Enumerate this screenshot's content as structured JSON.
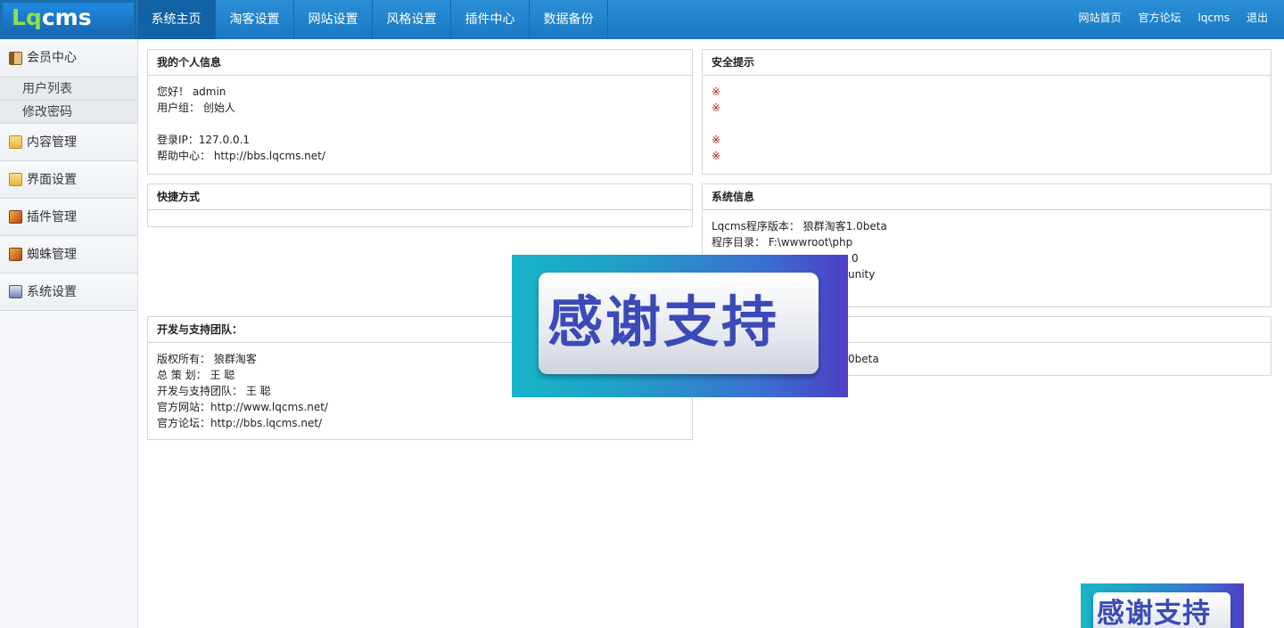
{
  "logo": {
    "part1": "Lq",
    "part2": "cms"
  },
  "nav": {
    "items": [
      {
        "label": "系统主页",
        "active": true
      },
      {
        "label": "淘客设置",
        "active": false
      },
      {
        "label": "网站设置",
        "active": false
      },
      {
        "label": "风格设置",
        "active": false
      },
      {
        "label": "插件中心",
        "active": false
      },
      {
        "label": "数据备份",
        "active": false
      }
    ]
  },
  "toplinks": [
    "网站首页",
    "官方论坛",
    "lqcms",
    "退出"
  ],
  "sidebar": {
    "member_center": "会员中心",
    "user_list": "用户列表",
    "change_password": "修改密码",
    "content_mgmt": "内容管理",
    "ui_settings": "界面设置",
    "plugin_mgmt": "插件管理",
    "spider_mgmt": "蜘蛛管理",
    "system_settings": "系统设置"
  },
  "profile": {
    "title": "我的个人信息",
    "hello": "您好！ admin",
    "group": "用户组： 创始人",
    "login_ip": "登录IP：127.0.0.1",
    "help": "帮助中心： http://bbs.lqcms.net/"
  },
  "security": {
    "title": "安全提示",
    "mark": "※"
  },
  "shortcuts": {
    "title": "快捷方式"
  },
  "sysinfo": {
    "title": "系统信息",
    "version": "Lqcms程序版本： 狼群淘客1.0beta",
    "dir": "程序目录： F:\\wwwroot\\php",
    "frag1": "0",
    "frag2": "unity"
  },
  "team": {
    "title": "开发与支持团队：",
    "copyright": "版权所有： 狼群淘客",
    "planner": "总 策 划： 王 聪",
    "dev": "开发与支持团队： 王 聪",
    "site": "官方网站：http://www.lqcms.net/",
    "forum": "官方论坛：http://bbs.lqcms.net/"
  },
  "update": {
    "frag": "0beta"
  },
  "banner": {
    "text": "感谢支持"
  }
}
